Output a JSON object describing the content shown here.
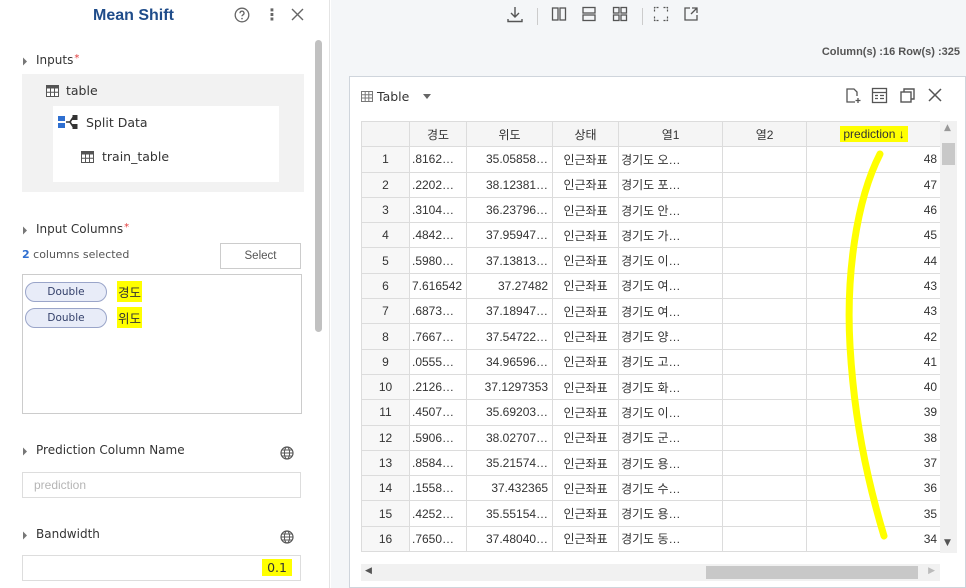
{
  "panel": {
    "title": "Mean Shift",
    "inputs_label": "Inputs",
    "input_table": "table",
    "split_data": "Split Data",
    "train_table": "train_table",
    "input_columns_label": "Input Columns",
    "columns_selected_count": "2",
    "columns_selected_suffix": "columns selected",
    "select_label": "Select",
    "columns": [
      {
        "type": "Double",
        "name": "경도"
      },
      {
        "type": "Double",
        "name": "위도"
      }
    ],
    "prediction_label": "Prediction Column Name",
    "prediction_placeholder": "prediction",
    "bandwidth_label": "Bandwidth",
    "bandwidth_value": "0.1"
  },
  "toolbar": {
    "info": "Column(s) :16  Row(s) :325"
  },
  "table": {
    "title": "Table",
    "headers": [
      "",
      "경도",
      "위도",
      "상태",
      "열1",
      "열2",
      "prediction ↓"
    ],
    "rows": [
      [
        "1",
        ".8162…",
        "35.05858…",
        "인근좌표",
        "경기도 오…",
        "",
        "48"
      ],
      [
        "2",
        ".2202…",
        "38.12381…",
        "인근좌표",
        "경기도 포…",
        "",
        "47"
      ],
      [
        "3",
        ".3104…",
        "36.23796…",
        "인근좌표",
        "경기도 안…",
        "",
        "46"
      ],
      [
        "4",
        ".4842…",
        "37.95947…",
        "인근좌표",
        "경기도 가…",
        "",
        "45"
      ],
      [
        "5",
        ".5980…",
        "37.13813…",
        "인근좌표",
        "경기도 이…",
        "",
        "44"
      ],
      [
        "6",
        "7.616542",
        "37.27482",
        "인근좌표",
        "경기도 여…",
        "",
        "43"
      ],
      [
        "7",
        ".6873…",
        "37.18947…",
        "인근좌표",
        "경기도 여…",
        "",
        "43"
      ],
      [
        "8",
        ".7667…",
        "37.54722…",
        "인근좌표",
        "경기도 양…",
        "",
        "42"
      ],
      [
        "9",
        ".0555…",
        "34.96596…",
        "인근좌표",
        "경기도 고…",
        "",
        "41"
      ],
      [
        "10",
        ".2126…",
        "37.1297353",
        "인근좌표",
        "경기도 화…",
        "",
        "40"
      ],
      [
        "11",
        ".4507…",
        "35.69203…",
        "인근좌표",
        "경기도 이…",
        "",
        "39"
      ],
      [
        "12",
        ".5906…",
        "38.02707…",
        "인근좌표",
        "경기도 군…",
        "",
        "38"
      ],
      [
        "13",
        ".8584…",
        "35.21574…",
        "인근좌표",
        "경기도 용…",
        "",
        "37"
      ],
      [
        "14",
        ".1558…",
        "37.432365",
        "인근좌표",
        "경기도 수…",
        "",
        "36"
      ],
      [
        "15",
        ".4252…",
        "35.55154…",
        "인근좌표",
        "경기도 용…",
        "",
        "35"
      ],
      [
        "16",
        ".7650…",
        "37.48040…",
        "인근좌표",
        "경기도 동…",
        "",
        "34"
      ]
    ]
  },
  "colors": {
    "highlight": "#ffff00",
    "title": "#1f4c8a",
    "required": "#e23b3b"
  }
}
